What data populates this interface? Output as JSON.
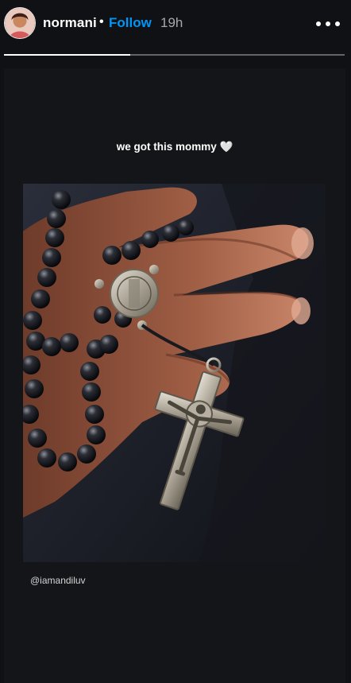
{
  "header": {
    "username": "normani",
    "separator": "•",
    "follow_label": "Follow",
    "time_ago": "19h"
  },
  "progress": {
    "fraction": 0.37
  },
  "story": {
    "caption": "we got this mommy 🤍",
    "mention": "@iamandiluv"
  },
  "icons": {
    "avatar": "profile-avatar",
    "more": "more-options-icon"
  },
  "colors": {
    "accent": "#0095f6",
    "background": "#101114"
  }
}
